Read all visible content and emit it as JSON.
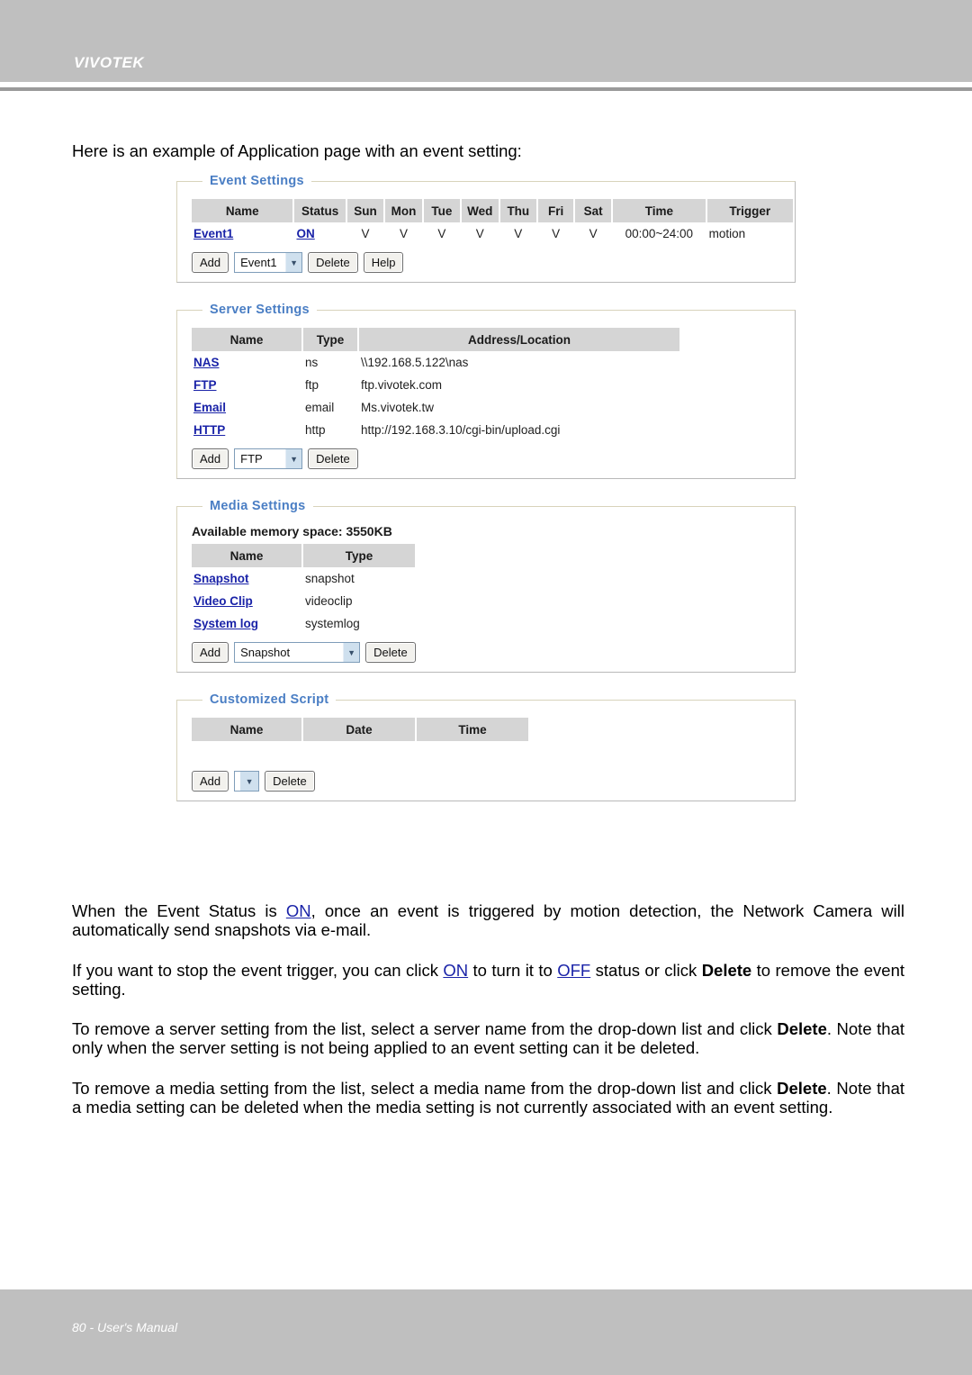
{
  "header": {
    "brand": "VIVOTEK"
  },
  "footer": {
    "text": "80 - User's Manual"
  },
  "intro": "Here is an example of Application page with an event setting:",
  "panels": {
    "event": {
      "legend": "Event Settings",
      "columns": [
        "Name",
        "Status",
        "Sun",
        "Mon",
        "Tue",
        "Wed",
        "Thu",
        "Fri",
        "Sat",
        "Time",
        "Trigger"
      ],
      "rows": [
        {
          "name": "Event1",
          "status": "ON",
          "sun": "V",
          "mon": "V",
          "tue": "V",
          "wed": "V",
          "thu": "V",
          "fri": "V",
          "sat": "V",
          "time": "00:00~24:00",
          "trigger": "motion"
        }
      ],
      "controls": {
        "add_label": "Add",
        "select_value": "Event1",
        "delete_label": "Delete",
        "help_label": "Help"
      }
    },
    "server": {
      "legend": "Server Settings",
      "columns": [
        "Name",
        "Type",
        "Address/Location"
      ],
      "rows": [
        {
          "name": "NAS",
          "type": "ns",
          "address": "\\\\192.168.5.122\\nas"
        },
        {
          "name": "FTP",
          "type": "ftp",
          "address": "ftp.vivotek.com"
        },
        {
          "name": "Email",
          "type": "email",
          "address": "Ms.vivotek.tw"
        },
        {
          "name": "HTTP",
          "type": "http",
          "address": "http://192.168.3.10/cgi-bin/upload.cgi"
        }
      ],
      "controls": {
        "add_label": "Add",
        "select_value": "FTP",
        "delete_label": "Delete"
      }
    },
    "media": {
      "legend": "Media Settings",
      "memory_note": "Available memory space: 3550KB",
      "columns": [
        "Name",
        "Type"
      ],
      "rows": [
        {
          "name": "Snapshot",
          "type": "snapshot"
        },
        {
          "name": "Video Clip",
          "type": "videoclip"
        },
        {
          "name": "System log",
          "type": "systemlog"
        }
      ],
      "controls": {
        "add_label": "Add",
        "select_value": "Snapshot",
        "delete_label": "Delete"
      }
    },
    "script": {
      "legend": "Customized Script",
      "columns": [
        "Name",
        "Date",
        "Time"
      ],
      "rows": [],
      "controls": {
        "add_label": "Add",
        "select_value": "",
        "delete_label": "Delete"
      }
    }
  },
  "paragraphs": {
    "p1_a": "When the Event Status is ",
    "p1_on": "ON",
    "p1_b": ", once an event is triggered by motion detection, the Network Camera will automatically send snapshots via e-mail.",
    "p2_a": "If you want to stop the event trigger, you can click ",
    "p2_on": "ON",
    "p2_b": " to turn it to ",
    "p2_off": "OFF",
    "p2_c": " status or click ",
    "p2_delete": "Delete",
    "p2_d": " to remove the event setting.",
    "p3_a": "To remove a server setting from the list, select a server name from the drop-down list and click ",
    "p3_delete": "Delete",
    "p3_b": ". Note that only when the server setting is not being applied to an event setting can it be deleted.",
    "p4_a": "To remove a media setting from the list, select a media name from the drop-down list and click ",
    "p4_delete": "Delete",
    "p4_b": ". Note that a media setting can be deleted when the media setting is not currently associated with an event setting."
  },
  "colors": {
    "header_band": "#bfbfbf",
    "legend_blue": "#4a7ec4",
    "link_blue": "#1a23a8",
    "table_header": "#d5d5d5",
    "panel_border": "#d8d3bb"
  }
}
